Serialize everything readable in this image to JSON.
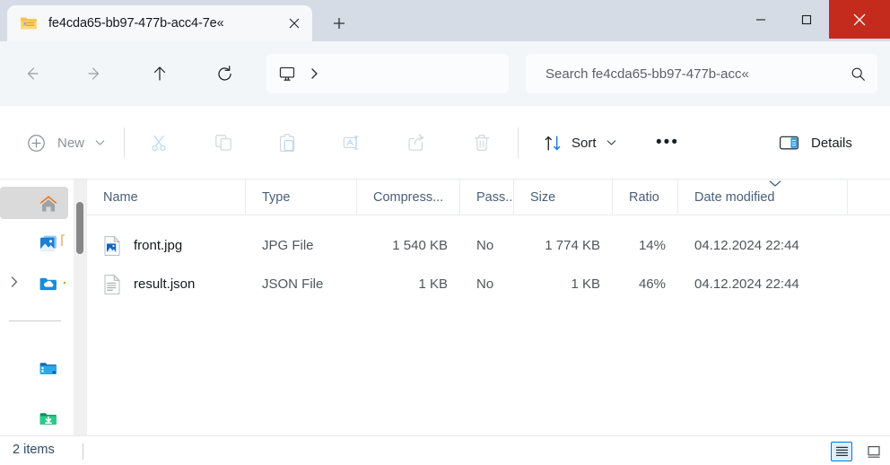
{
  "window": {
    "minimize_label": "Minimize",
    "maximize_label": "Maximize",
    "close_label": "Close"
  },
  "tab": {
    "title": "fe4cda65-bb97-477b-acc4-7e«",
    "icon": "zipped-folder-icon",
    "close_label": "×",
    "new_tab_label": "+"
  },
  "address": {
    "back_label": "Back",
    "forward_label": "Forward",
    "up_label": "Up",
    "refresh_label": "Refresh",
    "crumb_icon": "this-pc-icon",
    "crumb_chevron": "›"
  },
  "search": {
    "placeholder": "Search fe4cda65-bb97-477b-acc«",
    "icon": "search-icon"
  },
  "toolbar": {
    "new_label": "New",
    "new_chevron": "⌄",
    "cut_label": "Cut",
    "copy_label": "Copy",
    "paste_label": "Paste",
    "rename_label": "Rename",
    "share_label": "Share",
    "delete_label": "Delete",
    "sort_label": "Sort",
    "sort_chevron": "⌄",
    "more_label": "•••",
    "details_label": "Details"
  },
  "sidebar": {
    "items": [
      {
        "name": "home",
        "icon": "home-icon",
        "selected": true,
        "expandable": false
      },
      {
        "name": "pictures",
        "icon": "pictures-icon",
        "selected": false,
        "expandable": false
      },
      {
        "name": "onedrive",
        "icon": "onedrive-icon",
        "selected": false,
        "expandable": true
      },
      {
        "name": "desktop",
        "icon": "desktop-folder-icon",
        "selected": false,
        "expandable": false
      },
      {
        "name": "downloads",
        "icon": "downloads-folder-icon",
        "selected": false,
        "expandable": false
      }
    ]
  },
  "filelist": {
    "columns": [
      {
        "key": "name",
        "label": "Name",
        "align": "left"
      },
      {
        "key": "type",
        "label": "Type",
        "align": "left"
      },
      {
        "key": "compressed",
        "label": "Compress...",
        "align": "right"
      },
      {
        "key": "password",
        "label": "Pass...",
        "align": "left"
      },
      {
        "key": "size",
        "label": "Size",
        "align": "left"
      },
      {
        "key": "ratio",
        "label": "Ratio",
        "align": "left"
      },
      {
        "key": "date",
        "label": "Date modified",
        "align": "left"
      }
    ],
    "sorted_column": "Date modified",
    "sort_direction": "descending",
    "rows": [
      {
        "icon": "jpg-file-icon",
        "name": "front.jpg",
        "type": "JPG File",
        "compressed": "1 540 KB",
        "password": "No",
        "size": "1 774 KB",
        "ratio": "14%",
        "date": "04.12.2024 22:44"
      },
      {
        "icon": "json-file-icon",
        "name": "result.json",
        "type": "JSON File",
        "compressed": "1 KB",
        "password": "No",
        "size": "1 KB",
        "ratio": "46%",
        "date": "04.12.2024 22:44"
      }
    ]
  },
  "statusbar": {
    "item_count": "2 items",
    "details_view_label": "Details view",
    "large_icons_view_label": "Large icons view"
  },
  "colors": {
    "titlebar": "#d6dce5",
    "close_hover": "#c42b1c",
    "accent": "#0078d4",
    "header_text": "#4a6078",
    "selection": "#dadada"
  }
}
